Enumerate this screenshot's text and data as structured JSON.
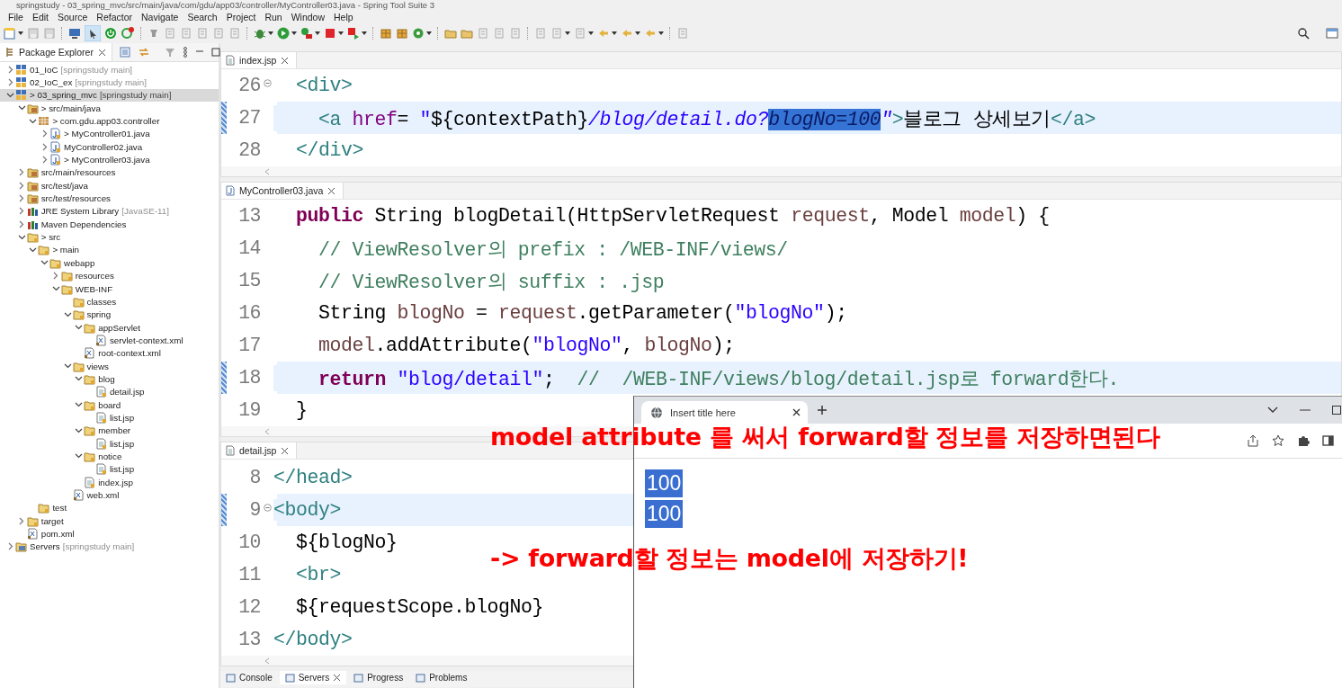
{
  "window": {
    "title": "springstudy - 03_spring_mvc/src/main/java/com/gdu/app03/controller/MyController03.java - Spring Tool Suite 3"
  },
  "menu": [
    "File",
    "Edit",
    "Source",
    "Refactor",
    "Navigate",
    "Search",
    "Project",
    "Run",
    "Window",
    "Help"
  ],
  "package_explorer": {
    "title": "Package Explorer",
    "tree": [
      {
        "label": "01_IoC",
        "detail": "[springstudy main]",
        "kind": "project",
        "expanded": false,
        "selected": false
      },
      {
        "label": "02_IoC_ex",
        "detail": "[springstudy main]",
        "kind": "project",
        "expanded": false,
        "selected": false
      },
      {
        "label": "> 03_spring_mvc",
        "detail": "[springstudy main]",
        "kind": "project",
        "expanded": true,
        "selected": true,
        "children": [
          {
            "label": "> src/main/java",
            "kind": "source",
            "expanded": true,
            "selected": false,
            "children": [
              {
                "label": "> com.gdu.app03.controller",
                "kind": "package",
                "expanded": true,
                "selected": false,
                "children": [
                  {
                    "label": "> MyController01.java",
                    "kind": "java",
                    "expanded": false,
                    "selected": false
                  },
                  {
                    "label": "MyController02.java",
                    "kind": "java",
                    "expanded": false,
                    "selected": false
                  },
                  {
                    "label": "> MyController03.java",
                    "kind": "java",
                    "expanded": false,
                    "selected": false
                  }
                ]
              }
            ]
          },
          {
            "label": "src/main/resources",
            "kind": "source",
            "expanded": false,
            "selected": false
          },
          {
            "label": "src/test/java",
            "kind": "source",
            "expanded": false,
            "selected": false
          },
          {
            "label": "src/test/resources",
            "kind": "source",
            "expanded": false,
            "selected": false
          },
          {
            "label": "JRE System Library",
            "detail": "[JavaSE-11]",
            "kind": "library",
            "expanded": false,
            "selected": false
          },
          {
            "label": "Maven Dependencies",
            "kind": "library",
            "expanded": false,
            "selected": false
          },
          {
            "label": "> src",
            "kind": "folder",
            "expanded": true,
            "selected": false,
            "children": [
              {
                "label": "> main",
                "kind": "folder",
                "expanded": true,
                "selected": false,
                "children": [
                  {
                    "label": "webapp",
                    "kind": "folder",
                    "expanded": true,
                    "selected": false,
                    "children": [
                      {
                        "label": "resources",
                        "kind": "folder",
                        "expanded": false,
                        "selected": false
                      },
                      {
                        "label": "WEB-INF",
                        "kind": "folder",
                        "expanded": true,
                        "selected": false,
                        "children": [
                          {
                            "label": "classes",
                            "kind": "folder",
                            "selected": false
                          },
                          {
                            "label": "spring",
                            "kind": "folder",
                            "expanded": true,
                            "selected": false,
                            "children": [
                              {
                                "label": "appServlet",
                                "kind": "folder",
                                "expanded": true,
                                "selected": false,
                                "children": [
                                  {
                                    "label": "servlet-context.xml",
                                    "kind": "xml",
                                    "selected": false
                                  }
                                ]
                              },
                              {
                                "label": "root-context.xml",
                                "kind": "xml",
                                "selected": false
                              }
                            ]
                          },
                          {
                            "label": "views",
                            "kind": "folder",
                            "expanded": true,
                            "selected": false,
                            "children": [
                              {
                                "label": "blog",
                                "kind": "folder",
                                "expanded": true,
                                "selected": false,
                                "children": [
                                  {
                                    "label": "detail.jsp",
                                    "kind": "file",
                                    "selected": false
                                  }
                                ]
                              },
                              {
                                "label": "board",
                                "kind": "folder",
                                "expanded": true,
                                "selected": false,
                                "children": [
                                  {
                                    "label": "list.jsp",
                                    "kind": "file",
                                    "selected": false
                                  }
                                ]
                              },
                              {
                                "label": "member",
                                "kind": "folder",
                                "expanded": true,
                                "selected": false,
                                "children": [
                                  {
                                    "label": "list.jsp",
                                    "kind": "file",
                                    "selected": false
                                  }
                                ]
                              },
                              {
                                "label": "notice",
                                "kind": "folder",
                                "expanded": true,
                                "selected": false,
                                "children": [
                                  {
                                    "label": "list.jsp",
                                    "kind": "file",
                                    "selected": false
                                  }
                                ]
                              },
                              {
                                "label": "index.jsp",
                                "kind": "file",
                                "selected": false
                              }
                            ]
                          },
                          {
                            "label": "web.xml",
                            "kind": "xml",
                            "selected": false
                          }
                        ]
                      }
                    ]
                  }
                ]
              },
              {
                "label": "test",
                "kind": "folder",
                "selected": false
              }
            ]
          },
          {
            "label": "target",
            "kind": "folder",
            "expanded": false,
            "selected": false
          },
          {
            "label": "pom.xml",
            "kind": "xml",
            "selected": false
          }
        ]
      },
      {
        "label": "Servers",
        "detail": "[springstudy main]",
        "kind": "server",
        "expanded": false,
        "selected": false
      }
    ]
  },
  "editors": [
    {
      "tab": "index.jsp",
      "kind": "jsp",
      "lines": [
        {
          "number": "26",
          "fold": true,
          "highlighted": false,
          "tokens": [
            {
              "kind": "tag",
              "text": "  <div>"
            }
          ]
        },
        {
          "number": "27",
          "fold": false,
          "highlighted": true,
          "tokens": [
            {
              "kind": "tag",
              "text": "    <a "
            },
            {
              "kind": "attr",
              "text": "href"
            },
            {
              "kind": "plain",
              "text": "= "
            },
            {
              "kind": "string",
              "text": "\""
            },
            {
              "kind": "plain",
              "text": "${contextPath}"
            },
            {
              "kind": "string-italic",
              "text": "/blog/detail.do?"
            },
            {
              "kind": "selection",
              "text": "blogNo=100"
            },
            {
              "kind": "string-italic",
              "text": "\""
            },
            {
              "kind": "tag",
              "text": ">"
            },
            {
              "kind": "plain",
              "text": "블로그 상세보기"
            },
            {
              "kind": "tag",
              "text": "</a>"
            }
          ]
        },
        {
          "number": "28",
          "fold": false,
          "highlighted": false,
          "tokens": [
            {
              "kind": "tag",
              "text": "  </div>"
            }
          ]
        }
      ]
    },
    {
      "tab": "MyController03.java",
      "kind": "java",
      "lines": [
        {
          "number": "13",
          "fold": false,
          "highlighted": false,
          "tokens": [
            {
              "kind": "keyword",
              "text": "  public"
            },
            {
              "kind": "plain",
              "text": " String blogDetail(HttpServletRequest "
            },
            {
              "kind": "variable",
              "text": "request"
            },
            {
              "kind": "plain",
              "text": ", Model "
            },
            {
              "kind": "variable",
              "text": "model"
            },
            {
              "kind": "plain",
              "text": ") {"
            }
          ]
        },
        {
          "number": "14",
          "fold": false,
          "highlighted": false,
          "tokens": [
            {
              "kind": "comment",
              "text": "    // ViewResolver의 prefix : /WEB-INF/views/"
            }
          ]
        },
        {
          "number": "15",
          "fold": false,
          "highlighted": false,
          "tokens": [
            {
              "kind": "comment",
              "text": "    // ViewResolver의 suffix : .jsp"
            }
          ]
        },
        {
          "number": "16",
          "fold": false,
          "highlighted": false,
          "tokens": [
            {
              "kind": "plain",
              "text": "    String "
            },
            {
              "kind": "variable",
              "text": "blogNo"
            },
            {
              "kind": "plain",
              "text": " = "
            },
            {
              "kind": "variable",
              "text": "request"
            },
            {
              "kind": "plain",
              "text": ".getParameter("
            },
            {
              "kind": "string",
              "text": "\"blogNo\""
            },
            {
              "kind": "plain",
              "text": ");"
            }
          ]
        },
        {
          "number": "17",
          "fold": false,
          "highlighted": false,
          "tokens": [
            {
              "kind": "variable",
              "text": "    model"
            },
            {
              "kind": "plain",
              "text": ".addAttribute("
            },
            {
              "kind": "string",
              "text": "\"blogNo\""
            },
            {
              "kind": "plain",
              "text": ", "
            },
            {
              "kind": "variable",
              "text": "blogNo"
            },
            {
              "kind": "plain",
              "text": ");"
            }
          ]
        },
        {
          "number": "18",
          "fold": false,
          "highlighted": true,
          "tokens": [
            {
              "kind": "keyword",
              "text": "    return "
            },
            {
              "kind": "string",
              "text": "\"blog/detail\""
            },
            {
              "kind": "plain",
              "text": ";  "
            },
            {
              "kind": "comment",
              "text": "//  /WEB-INF/views/blog/detail.jsp로 forward한다."
            }
          ]
        },
        {
          "number": "19",
          "fold": false,
          "highlighted": false,
          "tokens": [
            {
              "kind": "plain",
              "text": "  }"
            }
          ]
        }
      ]
    },
    {
      "tab": "detail.jsp",
      "kind": "jsp",
      "lines": [
        {
          "number": "8",
          "fold": false,
          "highlighted": false,
          "tokens": [
            {
              "kind": "tag",
              "text": "</head>"
            }
          ]
        },
        {
          "number": "9",
          "fold": true,
          "highlighted": true,
          "tokens": [
            {
              "kind": "tag",
              "text": "<body>"
            }
          ]
        },
        {
          "number": "10",
          "fold": false,
          "highlighted": false,
          "tokens": [
            {
              "kind": "plain",
              "text": "  ${blogNo}"
            }
          ]
        },
        {
          "number": "11",
          "fold": false,
          "highlighted": false,
          "tokens": [
            {
              "kind": "tag",
              "text": "  <br>"
            }
          ]
        },
        {
          "number": "12",
          "fold": false,
          "highlighted": false,
          "tokens": [
            {
              "kind": "plain",
              "text": "  ${requestScope.blogNo}"
            }
          ]
        },
        {
          "number": "13",
          "fold": false,
          "highlighted": false,
          "tokens": [
            {
              "kind": "tag",
              "text": "</body>"
            }
          ]
        }
      ]
    }
  ],
  "bottom_tabs": [
    {
      "label": "Console",
      "selected": false
    },
    {
      "label": "Servers",
      "selected": true
    },
    {
      "label": "Progress",
      "selected": false
    },
    {
      "label": "Problems",
      "selected": false
    }
  ],
  "browser": {
    "tab_title": "Insert title here",
    "content": [
      "100",
      "100"
    ]
  },
  "annotations": [
    "model attribute 를 써서 forward할 정보를 저장하면된다",
    "-> forward할 정보는 model에 저장하기!"
  ]
}
